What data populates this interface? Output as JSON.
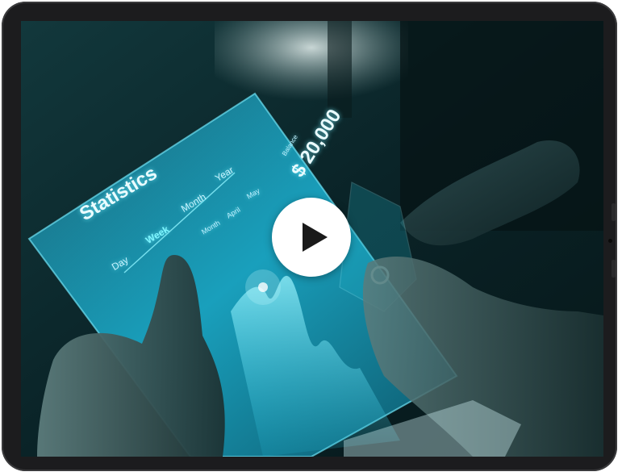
{
  "video": {
    "play_icon": "play-icon",
    "play_button_color": "#ffffff",
    "play_icon_color": "#1a1a1a"
  },
  "tablet_ui": {
    "title": "Statistics",
    "tabs": [
      "Day",
      "Week",
      "Month",
      "Year"
    ],
    "active_tab": "Week",
    "sub_tabs": [
      "Month",
      "April",
      "May"
    ],
    "amount": "$ 20,000",
    "amount_label": "Balance"
  },
  "frame": {
    "bezel_color": "#1c1c1e"
  }
}
